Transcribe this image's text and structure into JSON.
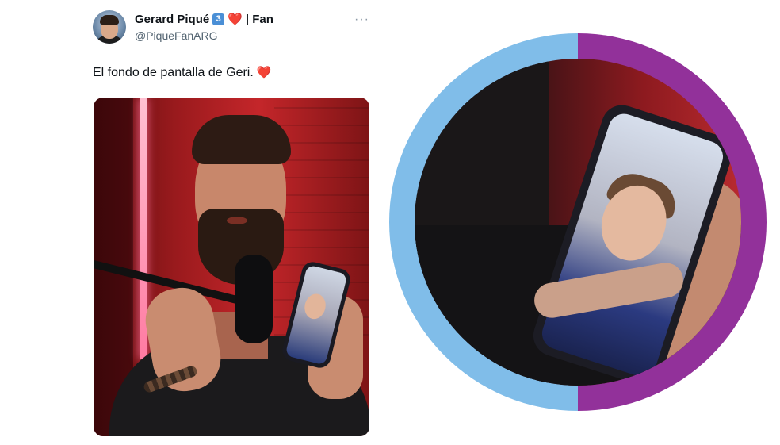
{
  "tweet": {
    "display_name": "Gerard Piqué",
    "badge_emoji": "3",
    "name_suffix": "| Fan",
    "handle": "@PiqueFanARG",
    "more_label": "···",
    "text": "El fondo de pantalla de Geri.",
    "heart": "❤️"
  },
  "colors": {
    "ring_left": "#80bde9",
    "ring_right": "#92319a",
    "heart": "#e0245e"
  },
  "icons": {
    "more": "more-options-icon",
    "heart": "heart-icon"
  }
}
